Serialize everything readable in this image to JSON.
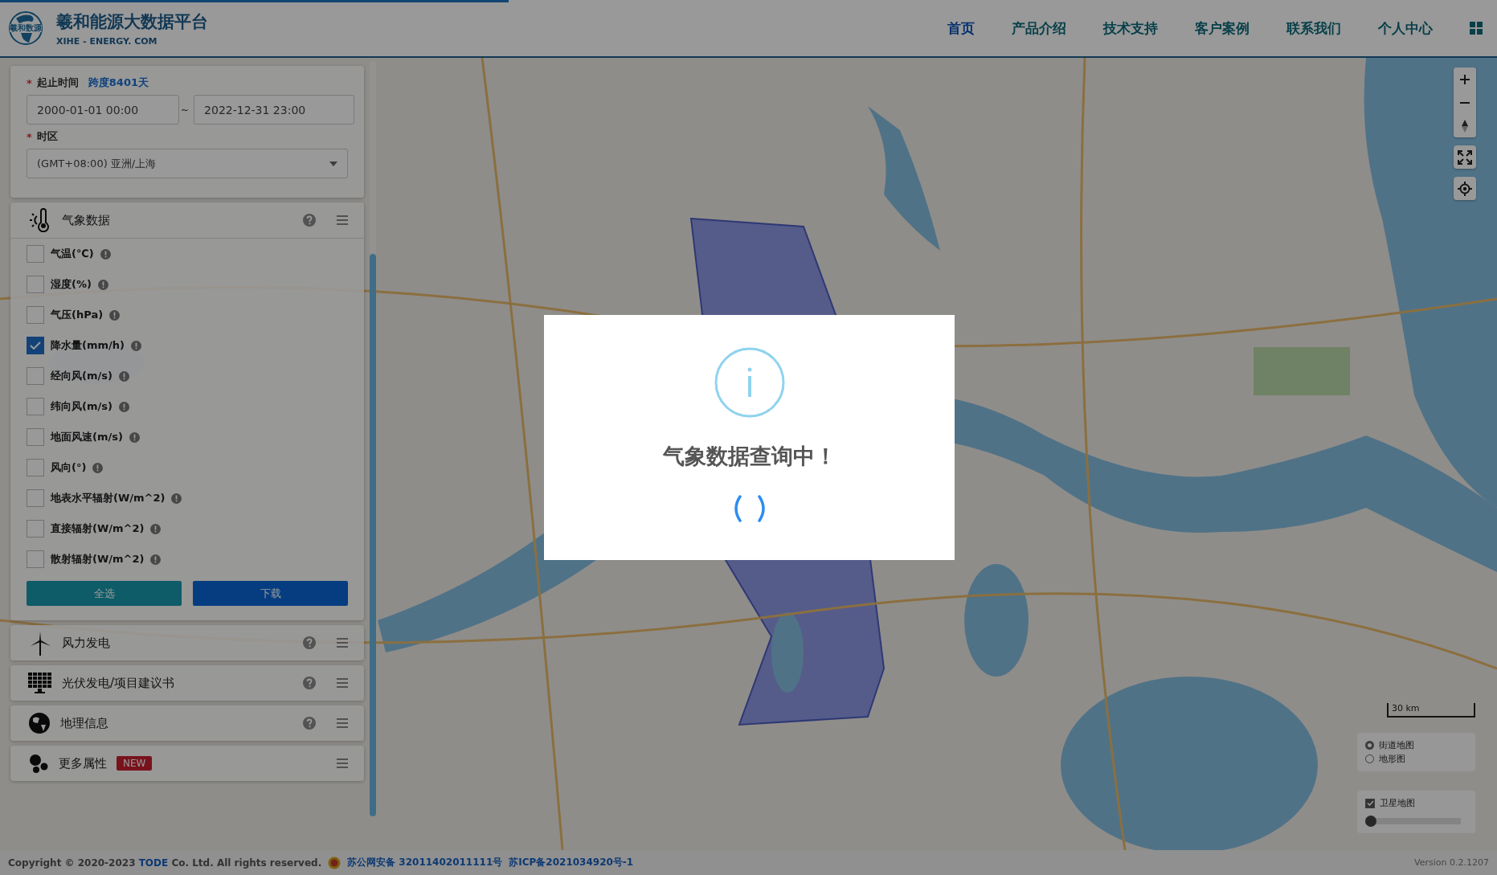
{
  "loading_bar": {
    "level": 0.34
  },
  "header": {
    "logo_text": "羲和数源",
    "title": "羲和能源大数据平台",
    "subtitle": "XIHE - ENERGY. COM",
    "nav": [
      {
        "label": "首页",
        "selected": true
      },
      {
        "label": "产品介绍",
        "selected": false
      },
      {
        "label": "技术支持",
        "selected": false
      },
      {
        "label": "客户案例",
        "selected": false
      },
      {
        "label": "联系我们",
        "selected": false
      },
      {
        "label": "个人中心",
        "selected": false
      }
    ]
  },
  "query_panel": {
    "time_range": {
      "required_mark": "*",
      "label": "起止时间",
      "span": "跨度8401天",
      "start": "2000-01-01 00:00",
      "separator": "~",
      "end": "2022-12-31 23:00"
    },
    "timezone": {
      "required_mark": "*",
      "label": "时区",
      "value": "(GMT+08:00) 亚洲/上海"
    }
  },
  "sections": [
    {
      "kind": "weather",
      "title": "气象数据",
      "help": true,
      "expanded": true,
      "variables": [
        {
          "label": "气温(℃)",
          "checked": false
        },
        {
          "label": "湿度(%)",
          "checked": false
        },
        {
          "label": "气压(hPa)",
          "checked": false
        },
        {
          "label": "降水量(mm/h)",
          "checked": true
        },
        {
          "label": "经向风(m/s)",
          "checked": false
        },
        {
          "label": "纬向风(m/s)",
          "checked": false
        },
        {
          "label": "地面风速(m/s)",
          "checked": false
        },
        {
          "label": "风向(°)",
          "checked": false
        },
        {
          "label": "地表水平辐射(W/m^2)",
          "checked": false
        },
        {
          "label": "直接辐射(W/m^2)",
          "checked": false
        },
        {
          "label": "散射辐射(W/m^2)",
          "checked": false
        }
      ],
      "buttons": [
        {
          "label": "全选",
          "kind": "select_all"
        },
        {
          "label": "下载",
          "kind": "download"
        }
      ]
    },
    {
      "kind": "wind",
      "title": "风力发电",
      "help": true,
      "expanded": false
    },
    {
      "kind": "solar",
      "title": "光伏发电/项目建议书",
      "help": true,
      "expanded": false
    },
    {
      "kind": "geo",
      "title": "地理信息",
      "help": true,
      "expanded": false
    },
    {
      "kind": "more",
      "title": "更多属性",
      "badge": "NEW",
      "help": false,
      "expanded": false
    }
  ],
  "map": {
    "scale": "30 km",
    "layers": [
      {
        "label": "街道地图",
        "selected": true
      },
      {
        "label": "地形图",
        "selected": false
      }
    ],
    "satellite": {
      "label": "卫星地图",
      "checked": true,
      "level": 0
    }
  },
  "dialog": {
    "title": "气象数据查询中！"
  },
  "footer": {
    "copyright_prefix": "Copyright © 2020-2023 ",
    "company": "TODE",
    "copyright_suffix": " Co. Ltd. All rights reserved.",
    "security_record": "苏公网安备 32011402011111号",
    "icp_record": "苏ICP备2021034920号-1",
    "version": "Version 0.2.1207"
  }
}
